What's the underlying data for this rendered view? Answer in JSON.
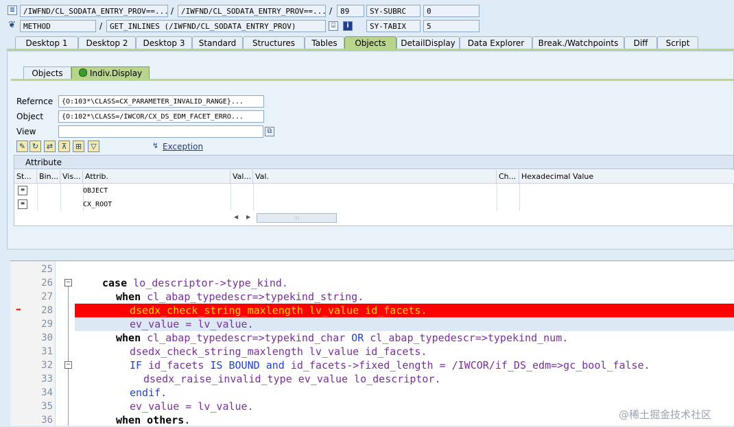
{
  "header": {
    "row1": {
      "program": "/IWFND/CL_SODATA_ENTRY_PROV==...",
      "include": "/IWFND/CL_SODATA_ENTRY_PROV==...",
      "line": "89",
      "var_name": "SY-SUBRC",
      "var_value": "0"
    },
    "row2": {
      "event_type": "METHOD",
      "event": "GET_INLINES (/IWFND/CL_SODATA_ENTRY_PROV)",
      "var_name": "SY-TABIX",
      "var_value": "5"
    }
  },
  "tabs": [
    {
      "label": "Desktop 1"
    },
    {
      "label": "Desktop 2"
    },
    {
      "label": "Desktop 3"
    },
    {
      "label": "Standard"
    },
    {
      "label": "Structures"
    },
    {
      "label": "Tables"
    },
    {
      "label": "Objects",
      "active": true
    },
    {
      "label": "DetailDisplay"
    },
    {
      "label": "Data Explorer"
    },
    {
      "label": "Break./Watchpoints"
    },
    {
      "label": "Diff"
    },
    {
      "label": "Script"
    }
  ],
  "subtabs": {
    "objects": "Objects",
    "indiv_display": "Indiv.Display"
  },
  "form": {
    "reference_label": "Refernce",
    "reference_value": "{O:103*\\CLASS=CX_PARAMETER_INVALID_RANGE}...",
    "object_label": "Object",
    "object_value": "{O:102*\\CLASS=/IWCOR/CX_DS_EDM_FACET_ERRO...",
    "view_label": "View",
    "view_value": ""
  },
  "toolbar": {
    "exception_label": "Exception"
  },
  "attribute_table": {
    "title": "Attribute",
    "columns": [
      "St...",
      "Bin...",
      "Vis...",
      "Attrib.",
      "Val...",
      "Val.",
      "Ch...",
      "Hexadecimal Value"
    ],
    "rows": [
      {
        "attrib": "OBJECT"
      },
      {
        "attrib": "CX_ROOT"
      }
    ]
  },
  "code": {
    "lines": [
      {
        "num": "25"
      },
      {
        "num": "26"
      },
      {
        "num": "27"
      },
      {
        "num": "28"
      },
      {
        "num": "29"
      },
      {
        "num": "30"
      },
      {
        "num": "31"
      },
      {
        "num": "32"
      },
      {
        "num": "33"
      },
      {
        "num": "34"
      },
      {
        "num": "35"
      },
      {
        "num": "36"
      }
    ],
    "t26a": "case",
    "t26b": "lo_descriptor->type_kind.",
    "t27a": "when",
    "t27b": "cl_abap_typedescr=>typekind_string.",
    "t28": "dsedx_check_string_maxlength lv_value id_facets.",
    "t29": "ev_value = lv_value.",
    "t30a": "when",
    "t30b": "cl_abap_typedescr=>typekind_char",
    "t30c": "OR",
    "t30d": "cl_abap_typedescr=>typekind_num.",
    "t31": "dsedx_check_string_maxlength lv_value id_facets.",
    "t32a": "IF",
    "t32b": "id_facets",
    "t32c": "IS BOUND",
    "t32d": "and",
    "t32e": "id_facets->fixed_length = /IWCOR/if_DS_edm=>gc_bool_false.",
    "t33": "dsedx_raise_invalid_type ev_value lo_descriptor.",
    "t34": "endif.",
    "t35": "ev_value = lv_value.",
    "t36a": "when others",
    "t36b": "."
  },
  "watermark": "@稀土掘金技术社区",
  "colors": {
    "active_tab": "#b9d58b",
    "breakpoint_line": "#ff0000",
    "breakpoint_text": "#ffd400",
    "keyword_blue": "#1f3fd6",
    "identifier_purple": "#7a2e9a"
  }
}
